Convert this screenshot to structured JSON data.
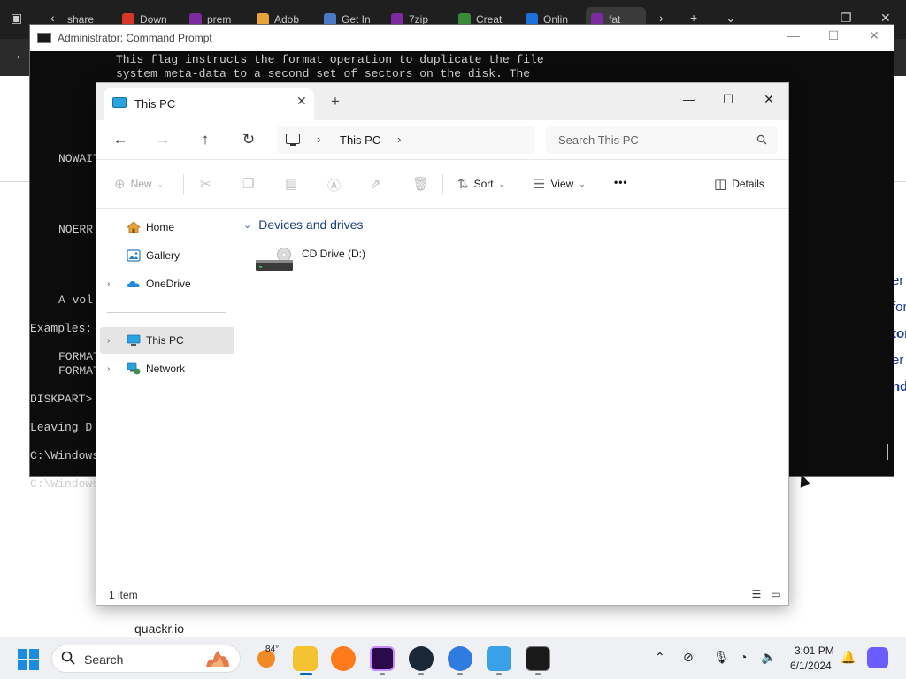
{
  "browser": {
    "tabs": [
      {
        "label": "share",
        "color": "#6a6a6a"
      },
      {
        "label": "Down",
        "color": "#d9362b"
      },
      {
        "label": "prem",
        "color": "#7b2aa0"
      },
      {
        "label": "Adob",
        "color": "#e8a33b"
      },
      {
        "label": "Get In",
        "color": "#4a79c7"
      },
      {
        "label": "7zip",
        "color": "#7b2aa0"
      },
      {
        "label": "Creat",
        "color": "#3a8a3a"
      },
      {
        "label": "Onlin",
        "color": "#1e6fd9"
      },
      {
        "label": "fat",
        "color": "#7b2aa0"
      }
    ],
    "footer_text": "quackr.io",
    "side_fragments": [
      "er",
      "for",
      "tor",
      "er",
      "nd"
    ]
  },
  "cmd": {
    "title": "Administrator: Command Prompt",
    "lines": [
      "    This flag instructs the format operation to duplicate the file",
      "    system meta-data to a second set of sectors on the disk. The",
      "",
      "",
      "",
      "",
      "",
      "NOWAIT",
      "",
      "",
      "",
      "",
      "NOERR",
      "",
      "",
      "",
      "",
      "A vol",
      "",
      "Examples:",
      "",
      "FORMAT",
      "FORMAT",
      "",
      "DISKPART>",
      "",
      "Leaving D",
      "",
      "C:\\Windows",
      "",
      "C:\\Windows"
    ]
  },
  "explorer": {
    "tab_label": "This PC",
    "tab_close": "✕",
    "tab_new": "+",
    "window_controls": {
      "minimize": "—",
      "maximize": "☐",
      "close": "✕"
    },
    "nav": {
      "back": "←",
      "forward": "→",
      "up": "↑",
      "refresh": "↻"
    },
    "breadcrumb": {
      "current": "This PC",
      "separator": "›"
    },
    "search_placeholder": "Search This PC",
    "command_bar": {
      "new_label": "New",
      "sort_label": "Sort",
      "view_label": "View",
      "more_label": "•••",
      "details_label": "Details"
    },
    "sidebar": {
      "items": [
        {
          "label": "Home"
        },
        {
          "label": "Gallery"
        },
        {
          "label": "OneDrive"
        },
        {
          "label": "This PC"
        },
        {
          "label": "Network"
        }
      ]
    },
    "content": {
      "group_header": "Devices and drives",
      "drives": [
        {
          "label": "CD Drive (D:)"
        }
      ]
    },
    "status": {
      "count": "1 item"
    }
  },
  "taskbar": {
    "search_label": "Search",
    "weather_temp": "84°",
    "clock_time": "3:01 PM",
    "clock_date": "6/1/2024"
  },
  "colors": {
    "accent": "#0067c0",
    "cmd_bg": "#0c0c0c",
    "selection": "#e5e5e5"
  }
}
